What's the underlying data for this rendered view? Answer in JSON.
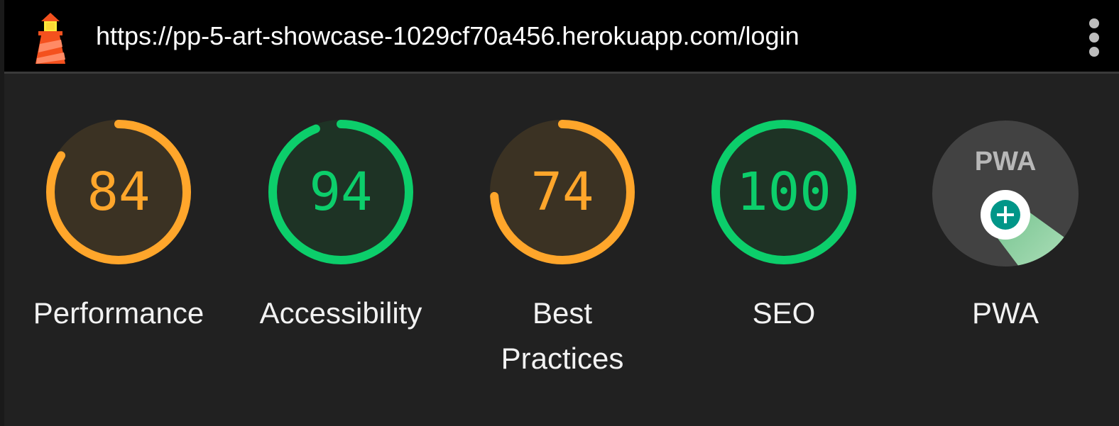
{
  "header": {
    "url": "https://pp-5-art-showcase-1029cf70a456.herokuapp.com/login",
    "logo_icon": "lighthouse-icon",
    "menu_icon": "more-vertical-icon"
  },
  "colors": {
    "average": "#ffa62b",
    "pass": "#0cce6b",
    "average_bg": "#3b3223",
    "pass_bg": "#1e3325",
    "pwa_bg": "#424242",
    "topbar_bg": "#000000",
    "page_bg": "#212121"
  },
  "categories": [
    {
      "key": "performance",
      "label": "Performance",
      "score": 84,
      "rating": "average"
    },
    {
      "key": "accessibility",
      "label": "Accessibility",
      "score": 94,
      "rating": "pass"
    },
    {
      "key": "best-practices",
      "label": "Best Practices",
      "score": 74,
      "rating": "average"
    },
    {
      "key": "seo",
      "label": "SEO",
      "score": 100,
      "rating": "pass"
    }
  ],
  "pwa": {
    "label": "PWA",
    "badge_text": "PWA",
    "icon": "pwa-badge-icon",
    "install_icon": "plus-icon"
  }
}
